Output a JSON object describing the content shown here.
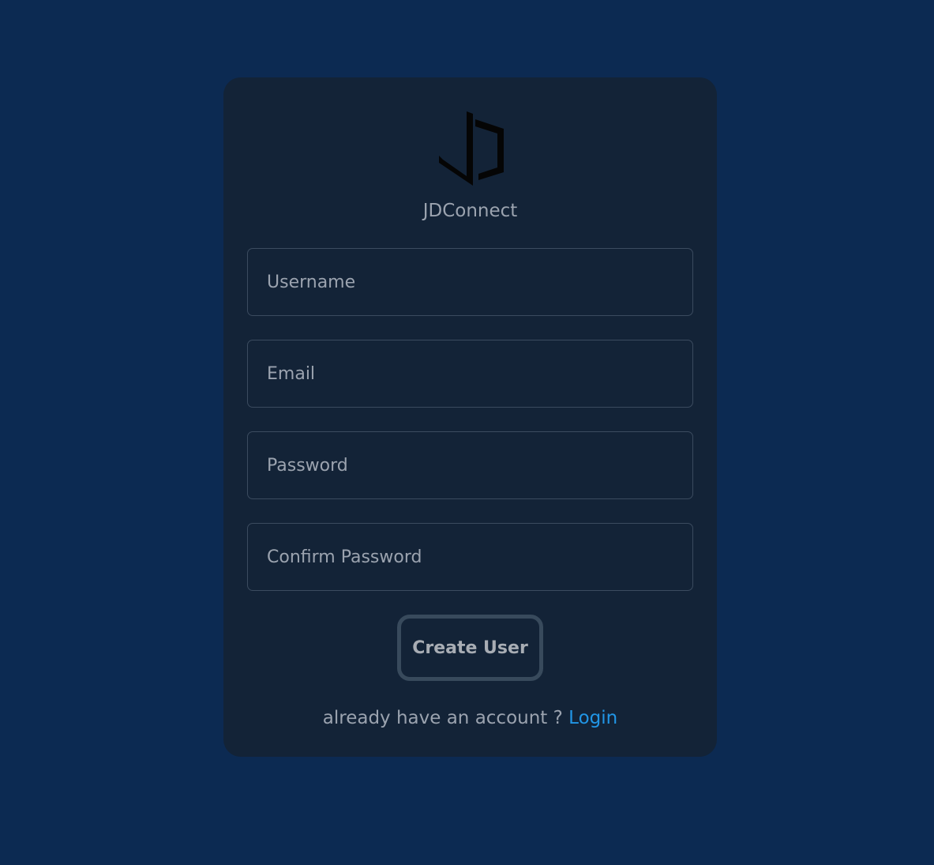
{
  "brand": {
    "logo_icon": "jd-logo-icon",
    "name": "JDConnect"
  },
  "form": {
    "username_placeholder": "Username",
    "email_placeholder": "Email",
    "password_placeholder": "Password",
    "confirm_password_placeholder": "Confirm Password",
    "submit_label": "Create User"
  },
  "footer": {
    "prompt": "already have an account ?",
    "login_label": "Login"
  },
  "colors": {
    "page_background": "#0c2a52",
    "card_background": "#132337",
    "link": "#2196e6",
    "button_border": "#384a5c"
  }
}
